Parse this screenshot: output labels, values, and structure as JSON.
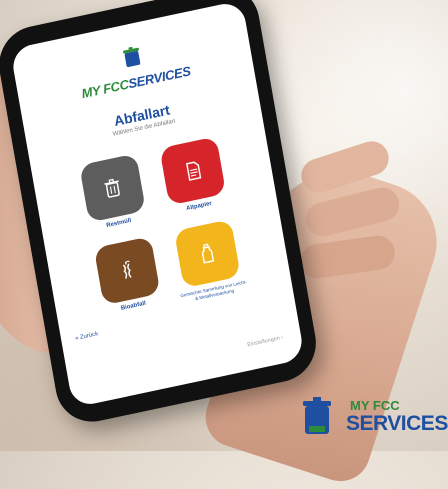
{
  "app": {
    "brand_my_fcc": "MY FCC",
    "brand_services": "SERVICES"
  },
  "screen": {
    "heading": "Abfallart",
    "subheading": "Wählen Sie die Abfallart",
    "back_label": "« Zurück",
    "settings_label": "Einstellungen ›"
  },
  "tiles": [
    {
      "label": "Restmüll",
      "color": "#5d5d5d",
      "icon": "trash-bin-icon"
    },
    {
      "label": "Altpapier",
      "color": "#d6252a",
      "icon": "paper-icon"
    },
    {
      "label": "Bioabfall",
      "color": "#7a4a22",
      "icon": "apple-core-icon"
    },
    {
      "label": "Gemischte Sammlung von Leicht- & Metallverpackung",
      "color": "#f2b51b",
      "icon": "bottle-icon"
    }
  ],
  "corner_brand": {
    "my_fcc": "MY FCC",
    "services": "SERVICES"
  },
  "colors": {
    "brand_green": "#2e8b3a",
    "brand_blue": "#1f4fa0"
  }
}
